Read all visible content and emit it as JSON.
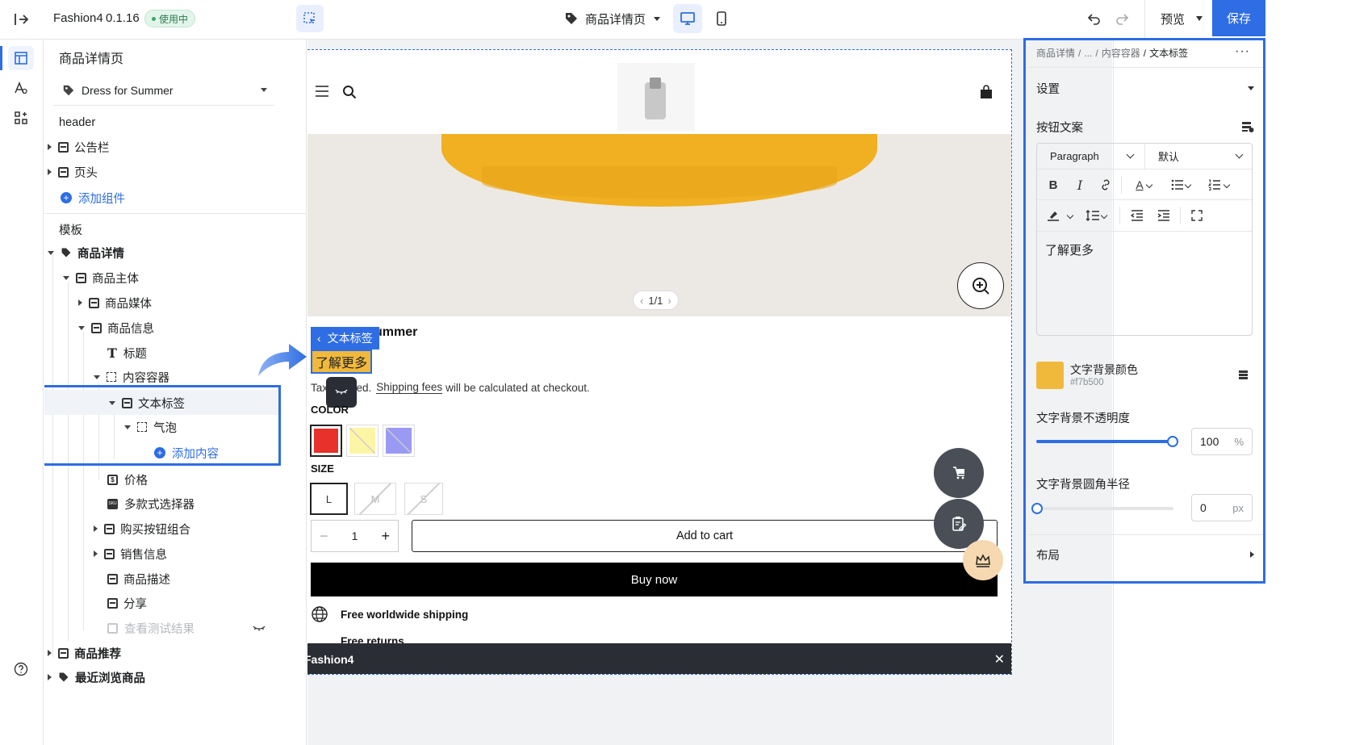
{
  "app": {
    "name": "Fashion4",
    "version": "0.1.16",
    "status_badge": "使用中"
  },
  "toolbar": {
    "page_selector": "商品详情页",
    "preview_label": "预览",
    "save_label": "保存"
  },
  "left_panel": {
    "title": "商品详情页",
    "product_selector": "Dress for Summer",
    "section_header": "header",
    "header_items": [
      {
        "label": "公告栏"
      },
      {
        "label": "页头"
      }
    ],
    "add_component": "添加组件",
    "section_template": "模板",
    "tree": {
      "product_detail": "商品详情",
      "product_main": "商品主体",
      "product_media": "商品媒体",
      "product_info": "商品信息",
      "title": "标题",
      "content_container": "内容容器",
      "text_label": "文本标签",
      "bubble": "气泡",
      "add_content": "添加内容",
      "price": "价格",
      "multi_style_selector": "多款式选择器",
      "buy_button_group": "购买按钮组合",
      "sales_info": "销售信息",
      "product_description": "商品描述",
      "share": "分享",
      "view_test_results": "查看测试结果",
      "product_recommend": "商品推荐",
      "recently_viewed": "最近浏览商品"
    }
  },
  "preview": {
    "image_pager": "1/1",
    "product_title_partial": "ummer",
    "text_label_tag": "文本标签",
    "learn_more_button": "了解更多",
    "tax_text_prefix": "Tax",
    "tax_text_rest": "ded.",
    "shipping_link": "Shipping fees",
    "shipping_suffix": "will be calculated at checkout.",
    "color_label": "COLOR",
    "colors": [
      "#e8312a",
      "#fdf5a6",
      "#9a9af5"
    ],
    "size_label": "SIZE",
    "sizes": [
      {
        "label": "L",
        "available": true
      },
      {
        "label": "M",
        "available": false
      },
      {
        "label": "S",
        "available": false
      }
    ],
    "quantity": "1",
    "add_to_cart": "Add to cart",
    "buy_now": "Buy now",
    "free_shipping": "Free worldwide shipping",
    "free_returns_partial": "Free returns",
    "bottom_bar_title": "Fashion4"
  },
  "right_panel": {
    "breadcrumb": {
      "part1": "商品详情",
      "sep": "/",
      "ellipsis": "...",
      "part2": "内容容器",
      "current": "文本标签"
    },
    "settings_label": "设置",
    "button_text_label": "按钮文案",
    "paragraph_select": "Paragraph",
    "default_select": "默认",
    "editor_content": "了解更多",
    "bg_color_label": "文字背景颜色",
    "bg_color_value": "#f7b500",
    "opacity_label": "文字背景不透明度",
    "opacity_value": "100",
    "opacity_unit": "%",
    "radius_label": "文字背景圆角半径",
    "radius_value": "0",
    "radius_unit": "px",
    "layout_label": "布局"
  },
  "colors": {
    "accent": "#2e6de3",
    "save_bg": "#2e6de3",
    "highlight_border": "#2e6de3",
    "badge_green": "#3aa86a",
    "swatch_yellow": "#f0b93b"
  }
}
